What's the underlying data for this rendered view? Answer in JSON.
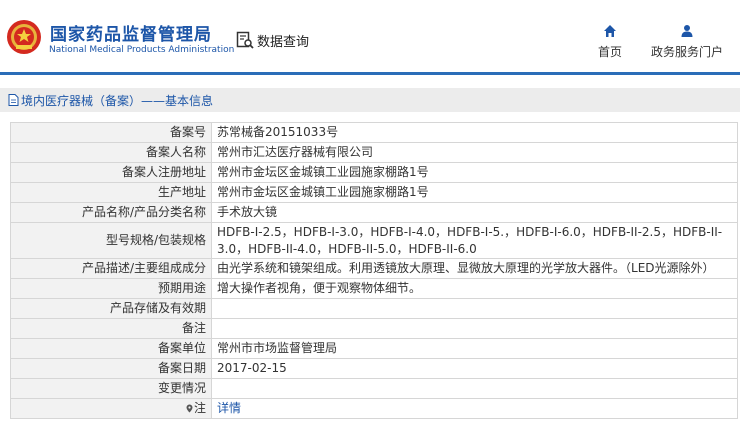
{
  "header": {
    "brand_cn": "国家药品监督管理局",
    "brand_en": "National Medical Products Administration",
    "search_label": "数据查询",
    "nav": [
      {
        "label": "首页",
        "icon": "home-icon"
      },
      {
        "label": "政务服务门户",
        "icon": "user-icon"
      }
    ]
  },
  "section": {
    "title": "境内医疗器械（备案）——基本信息"
  },
  "rows": [
    {
      "key": "备案号",
      "value": "苏常械备20151033号"
    },
    {
      "key": "备案人名称",
      "value": "常州市汇达医疗器械有限公司"
    },
    {
      "key": "备案人注册地址",
      "value": "常州市金坛区金城镇工业园施家棚路1号"
    },
    {
      "key": "生产地址",
      "value": "常州市金坛区金城镇工业园施家棚路1号"
    },
    {
      "key": "产品名称/产品分类名称",
      "value": "手术放大镜"
    },
    {
      "key": "型号规格/包装规格",
      "value": "HDFB-I-2.5，HDFB-I-3.0，HDFB-I-4.0，HDFB-I-5.，HDFB-I-6.0，HDFB-II-2.5，HDFB-II-3.0，HDFB-II-4.0，HDFB-II-5.0，HDFB-II-6.0"
    },
    {
      "key": "产品描述/主要组成成分",
      "value": "由光学系统和镜架组成。利用透镜放大原理、显微放大原理的光学放大器件。（LED光源除外）"
    },
    {
      "key": "预期用途",
      "value": "增大操作者视角，便于观察物体细节。"
    },
    {
      "key": "产品存储及有效期",
      "value": ""
    },
    {
      "key": "备注",
      "value": ""
    },
    {
      "key": "备案单位",
      "value": "常州市市场监督管理局"
    },
    {
      "key": "备案日期",
      "value": "2017-02-15"
    },
    {
      "key": "变更情况",
      "value": ""
    }
  ],
  "note_row": {
    "key": "注",
    "link": "详情"
  },
  "colors": {
    "brand_blue": "#1d56a8",
    "bar_blue": "#2a6db8",
    "key_bg": "#f2f2f2"
  }
}
